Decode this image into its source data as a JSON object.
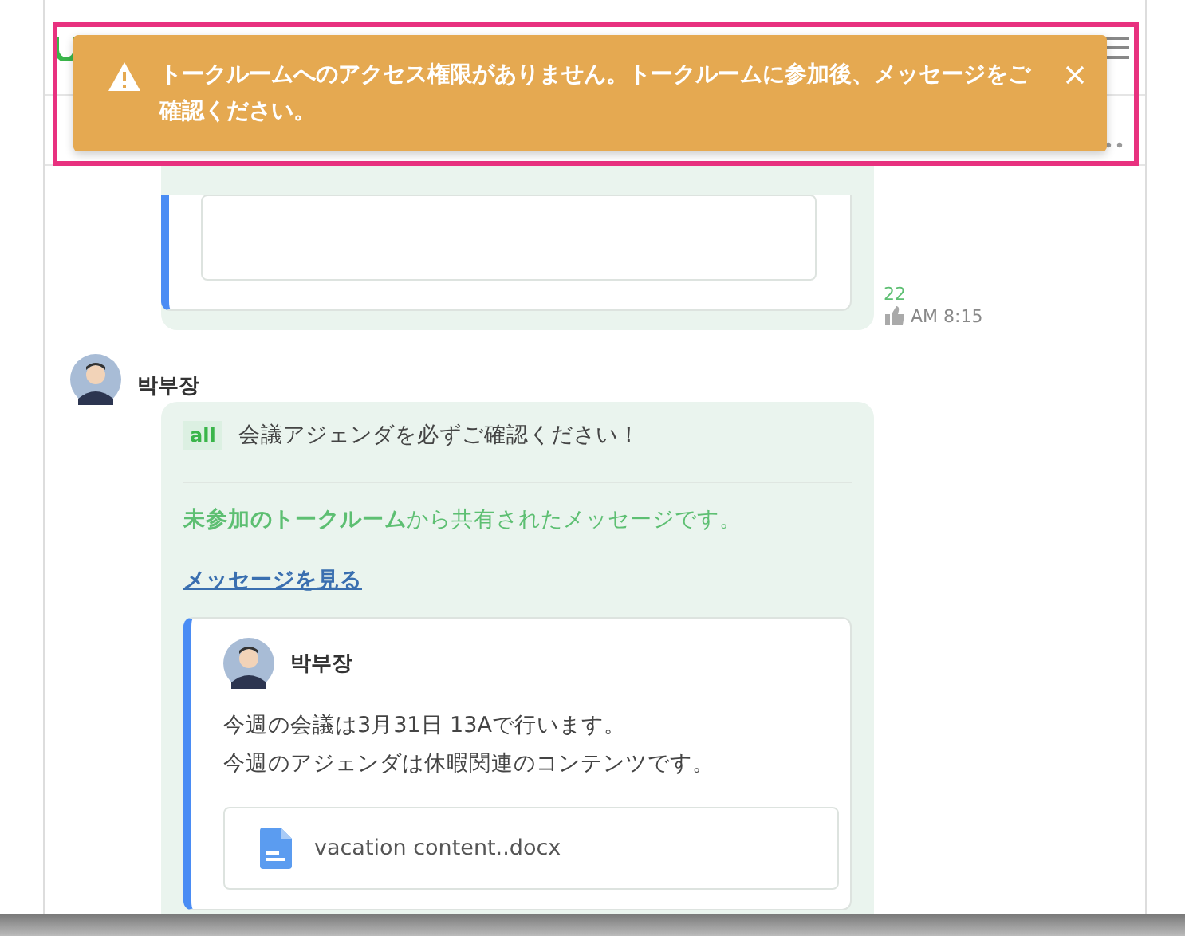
{
  "toast": {
    "message": "トークルームへのアクセス権限がありません。トークルームに参加後、メッセージをご確認ください。"
  },
  "previous_message": {
    "read_count": "22",
    "time": "AM 8:15"
  },
  "message": {
    "author": "박부장",
    "mention": "all",
    "text": "会議アジェンダを必ずご確認ください！",
    "notice": "**未参加のトークルーム**から共有されたメッセージです。",
    "link": "メッセージを見る",
    "quote": {
      "author": "박부장",
      "lines": [
        "今週の会議は3月31日 13Aで行います。",
        "今週のアジェンダは休暇関連のコンテンツです。"
      ],
      "file": "vacation content..docx"
    }
  }
}
